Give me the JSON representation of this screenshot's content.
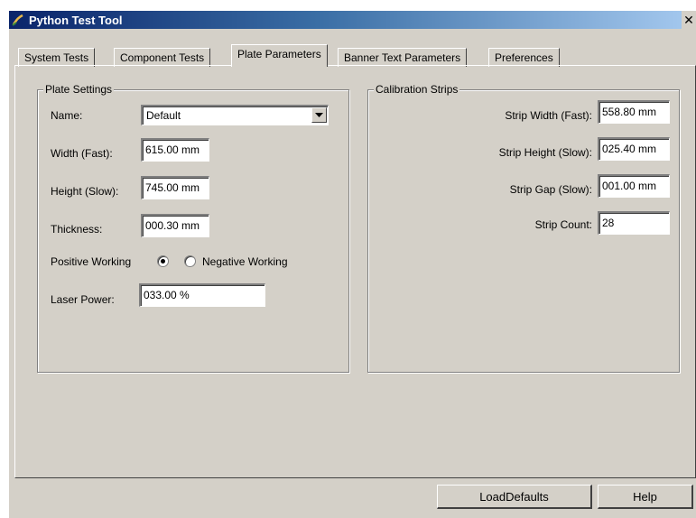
{
  "window": {
    "title": "Python Test Tool",
    "close_glyph": "✕"
  },
  "tabs": [
    {
      "label": "System Tests"
    },
    {
      "label": "Component Tests"
    },
    {
      "label": "Plate Parameters"
    },
    {
      "label": "Banner Text Parameters"
    },
    {
      "label": "Preferences"
    }
  ],
  "active_tab": "Plate Parameters",
  "plate_settings": {
    "legend": "Plate Settings",
    "name_label": "Name:",
    "name_value": "Default",
    "width_label": "Width (Fast):",
    "width_value": "615.00 mm",
    "height_label": "Height (Slow):",
    "height_value": "745.00 mm",
    "thickness_label": "Thickness:",
    "thickness_value": "000.30 mm",
    "positive_label": "Positive Working",
    "negative_label": "Negative Working",
    "selected_mode": "positive",
    "laser_label": "Laser Power:",
    "laser_value": "033.00 %"
  },
  "calibration": {
    "legend": "Calibration Strips",
    "strip_width_label": "Strip Width (Fast):",
    "strip_width_value": "558.80 mm",
    "strip_height_label": "Strip Height (Slow):",
    "strip_height_value": "025.40 mm",
    "strip_gap_label": "Strip Gap (Slow):",
    "strip_gap_value": "001.00 mm",
    "strip_count_label": "Strip Count:",
    "strip_count_value": "28"
  },
  "footer": {
    "load_defaults_label": "LoadDefaults",
    "help_label": "Help"
  }
}
